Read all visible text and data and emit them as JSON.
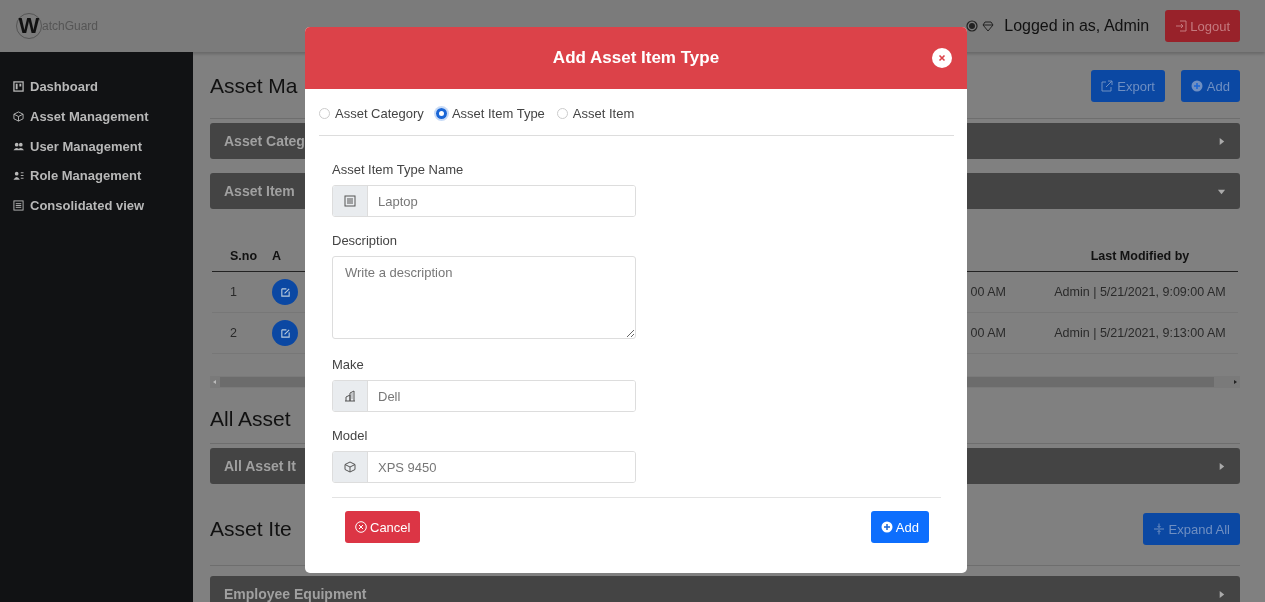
{
  "header": {
    "logo": {
      "initial": "W",
      "rest": "atchGuard"
    },
    "user_label": "Logged in as, Admin",
    "logout": "Logout"
  },
  "sidebar": {
    "items": [
      {
        "label": "Dashboard"
      },
      {
        "label": "Asset Management"
      },
      {
        "label": "User Management"
      },
      {
        "label": "Role Management"
      },
      {
        "label": "Consolidated view"
      }
    ]
  },
  "page": {
    "title": "Asset Ma",
    "actions": [
      {
        "label": "Export"
      },
      {
        "label": "Add"
      }
    ],
    "sections": [
      {
        "label": "Asset Categ",
        "expanded": false
      },
      {
        "label": "Asset Item",
        "expanded": true
      }
    ],
    "table": {
      "columns": [
        "S.no",
        "A",
        "Last Modified by"
      ],
      "rows": [
        {
          "sno": "1",
          "column_3": "00 AM",
          "last_modified": "Admin | 5/21/2021, 9:09:00 AM"
        },
        {
          "sno": "2",
          "column_3": "00 AM",
          "last_modified": "Admin | 5/21/2021, 9:13:00 AM"
        }
      ]
    },
    "all_heading": "All Asset",
    "all_section": {
      "label": "All Asset It",
      "expanded": false
    },
    "items_heading": "Asset Ite",
    "expand_all": "Expand All",
    "items_section": {
      "label": "Employee Equipment",
      "expanded": false
    }
  },
  "modal": {
    "title": "Add Asset Item Type",
    "radios": [
      {
        "label": "Asset Category",
        "selected": false
      },
      {
        "label": "Asset Item Type",
        "selected": true
      },
      {
        "label": "Asset Item",
        "selected": false
      }
    ],
    "fields": [
      {
        "kind": "input",
        "label": "Asset Item Type Name",
        "placeholder": "Laptop"
      },
      {
        "kind": "textarea",
        "label": "Description",
        "placeholder": "Write a description"
      },
      {
        "kind": "input",
        "label": "Make",
        "placeholder": "Dell"
      },
      {
        "kind": "input",
        "label": "Model",
        "placeholder": "XPS 9450"
      }
    ],
    "cancel": "Cancel",
    "submit": "Add"
  }
}
